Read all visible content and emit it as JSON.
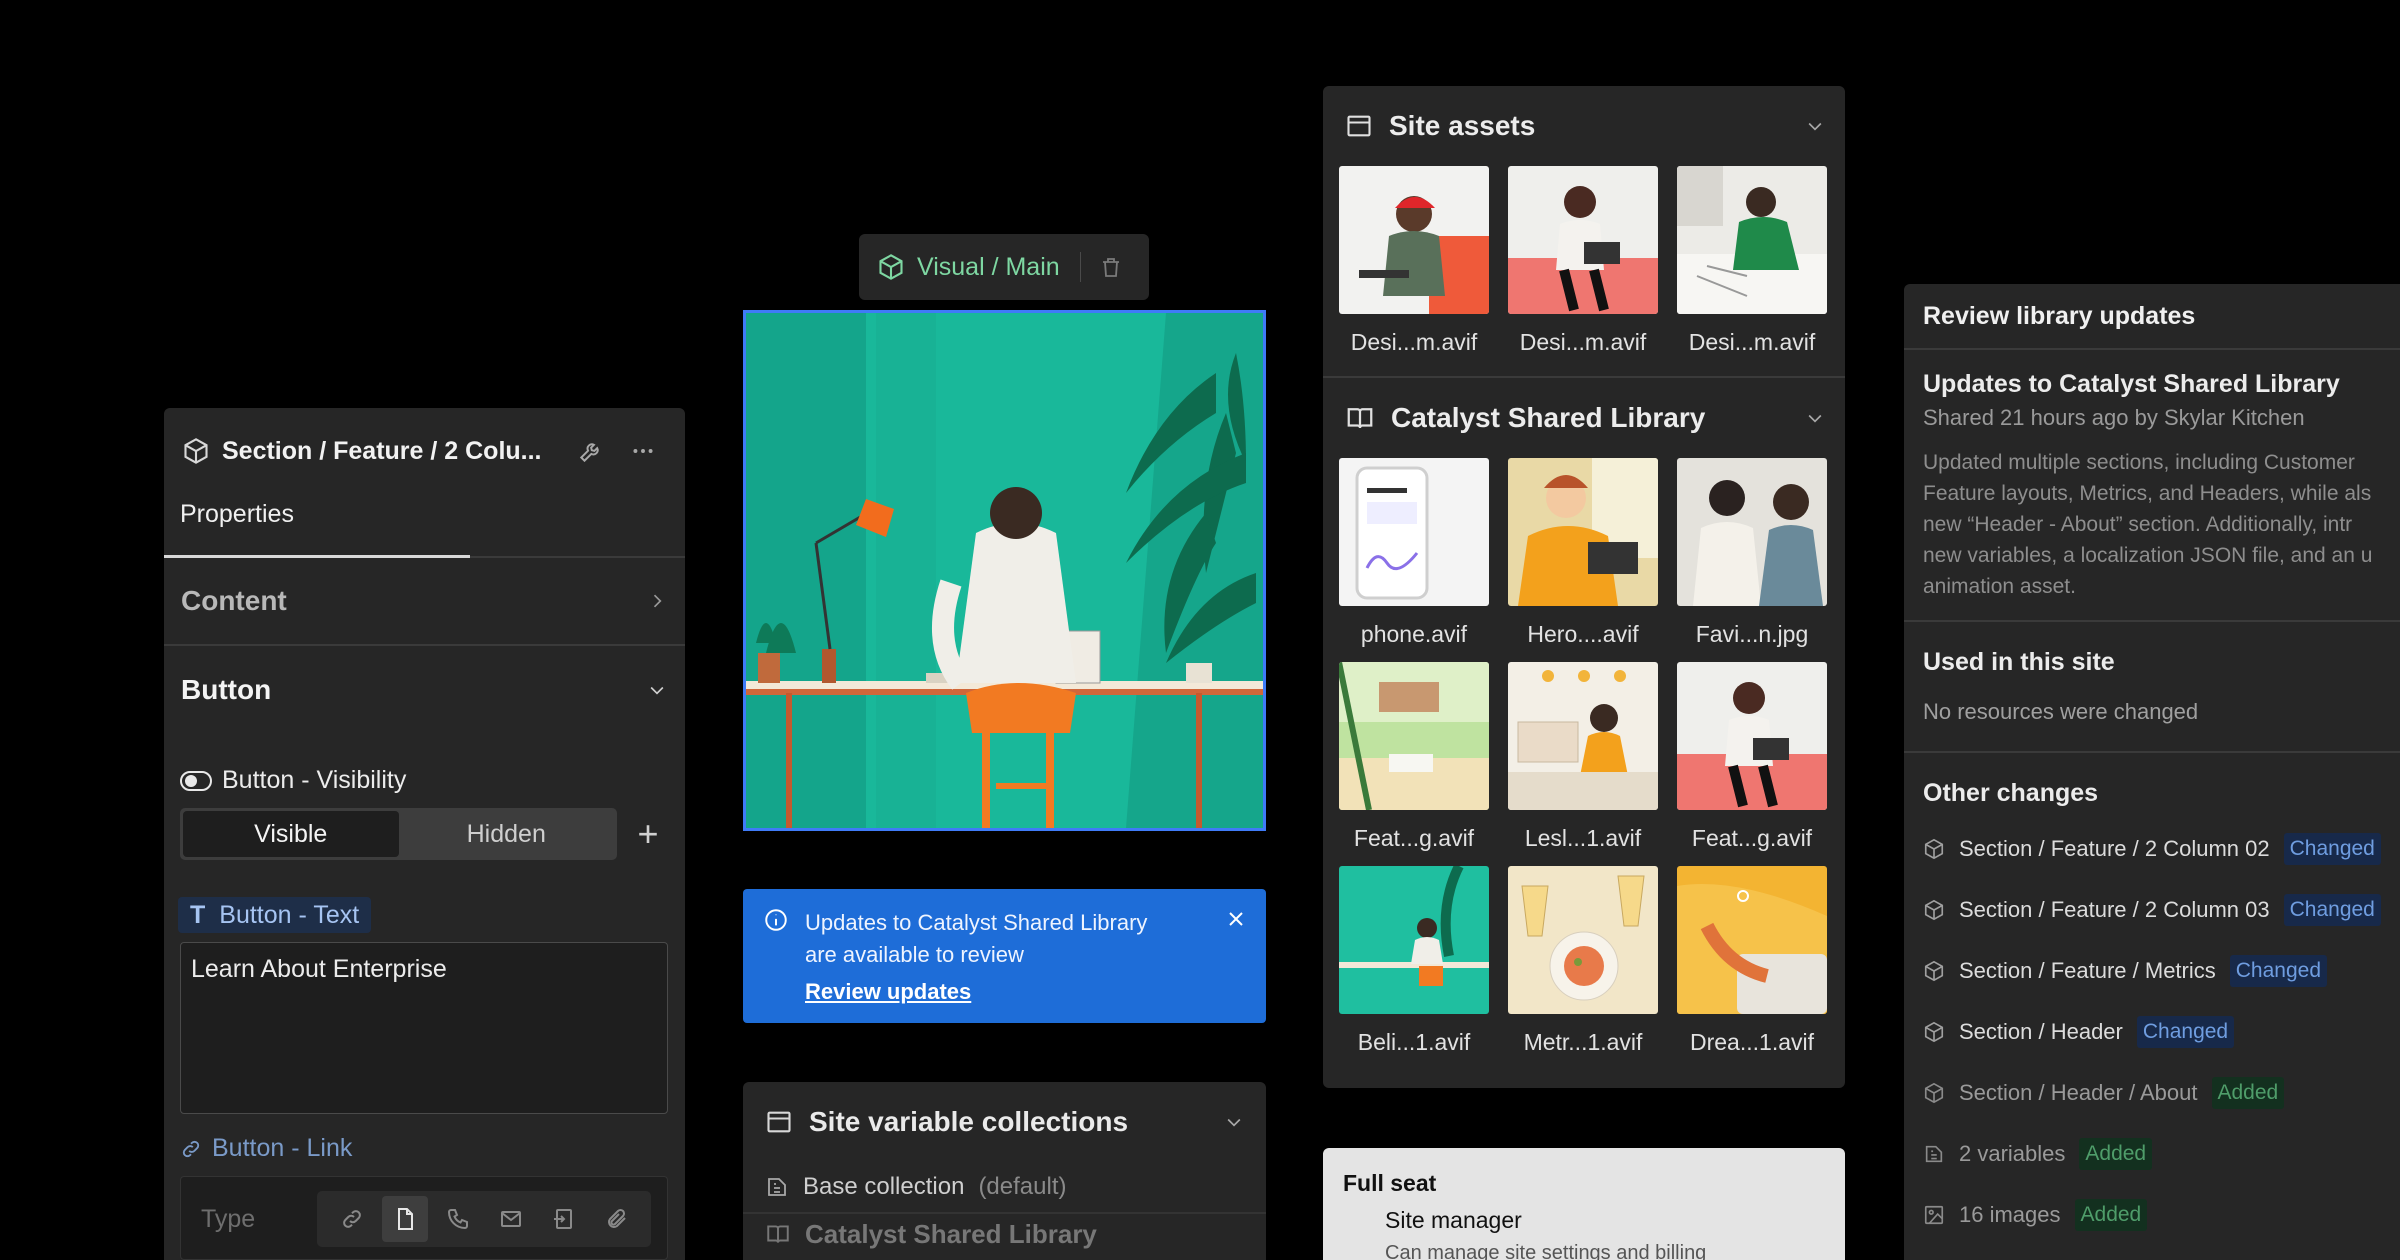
{
  "properties": {
    "title": "Section / Feature / 2 Colu...",
    "tab": "Properties",
    "content_row": "Content",
    "button_row": "Button",
    "visibility_label": "Button - Visibility",
    "visible": "Visible",
    "hidden": "Hidden",
    "text_label": "Button - Text",
    "text_value": "Learn About Enterprise",
    "link_label": "Button - Link",
    "type_label": "Type"
  },
  "badge": {
    "label": "Visual / Main"
  },
  "notice": {
    "message": "Updates to Catalyst Shared Library are available to review",
    "link": "Review updates"
  },
  "variables": {
    "title": "Site variable collections",
    "base": "Base collection",
    "base_note": "(default)",
    "next": "Catalyst Shared Library"
  },
  "assets": {
    "site_title": "Site assets",
    "site_items": [
      "Desi...m.avif",
      "Desi...m.avif",
      "Desi...m.avif"
    ],
    "library_title": "Catalyst Shared Library",
    "library_items": [
      "phone.avif",
      "Hero....avif",
      "Favi...n.jpg",
      "Feat...g.avif",
      "Lesl...1.avif",
      "Feat...g.avif",
      "Beli...1.avif",
      "Metr...1.avif",
      "Drea...1.avif"
    ]
  },
  "seat": {
    "title": "Full seat",
    "role": "Site manager",
    "desc": "Can manage site settings and billing"
  },
  "review": {
    "header": "Review library updates",
    "update_title": "Updates to Catalyst Shared Library",
    "shared_by": "Shared 21 hours ago by Skylar Kitchen",
    "desc_lines": [
      "Updated multiple sections, including Customer",
      "Feature layouts, Metrics, and Headers, while als",
      "new “Header - About” section. Additionally, intr",
      "new variables, a localization JSON file, and an u",
      "animation asset."
    ],
    "used_title": "Used in this site",
    "used_none": "No resources were changed",
    "other_title": "Other changes",
    "changes": [
      {
        "name": "Section / Feature / 2 Column 02",
        "status": "Changed",
        "kind": "changed",
        "icon": "cube-icon"
      },
      {
        "name": "Section / Feature / 2 Column 03",
        "status": "Changed",
        "kind": "changed",
        "icon": "cube-icon"
      },
      {
        "name": "Section / Feature / Metrics",
        "status": "Changed",
        "kind": "changed",
        "icon": "cube-icon"
      },
      {
        "name": "Section / Header",
        "status": "Changed",
        "kind": "changed",
        "icon": "cube-icon"
      },
      {
        "name": "Section / Header / About",
        "status": "Added",
        "kind": "added",
        "icon": "cube-icon"
      },
      {
        "name": "2 variables",
        "status": "Added",
        "kind": "added",
        "icon": "variable-icon"
      },
      {
        "name": "16 images",
        "status": "Added",
        "kind": "added",
        "icon": "image-icon"
      }
    ]
  },
  "colors": {
    "accent_blue": "#1e6dd8",
    "selection": "#3f7bf7",
    "teal": "#1fbfa0",
    "changed": "#6f9de0",
    "added": "#4f9d6a"
  }
}
